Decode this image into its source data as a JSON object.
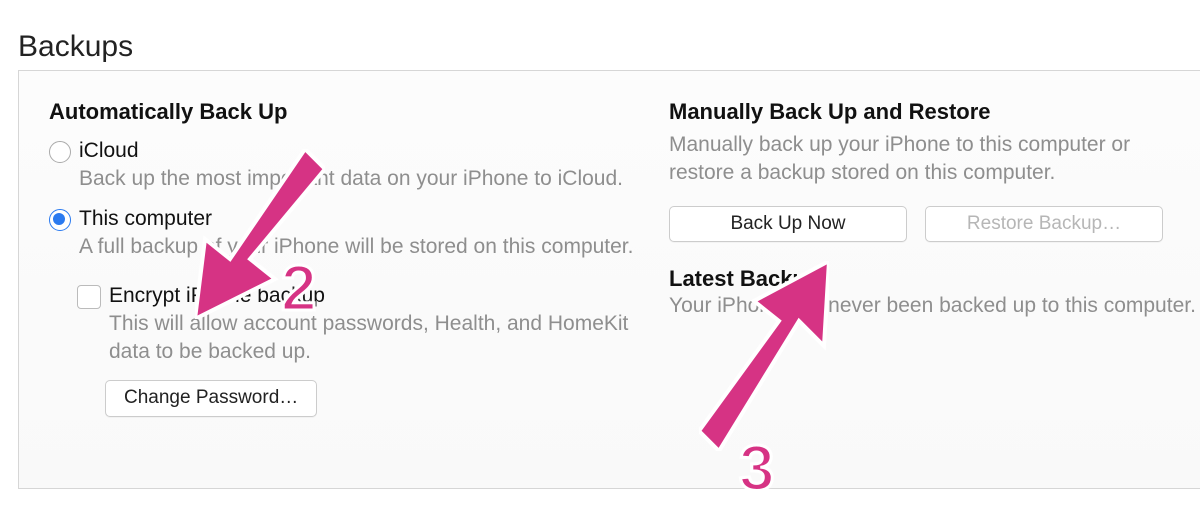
{
  "section_title": "Backups",
  "auto": {
    "heading": "Automatically Back Up",
    "icloud": {
      "label": "iCloud",
      "desc": "Back up the most important data on your iPhone to iCloud."
    },
    "this_computer": {
      "label": "This computer",
      "desc": "A full backup of your iPhone will be stored on this computer."
    },
    "encrypt": {
      "label": "Encrypt iPhone backup",
      "desc": "This will allow account passwords, Health, and HomeKit data to be backed up."
    },
    "change_password": "Change Password…"
  },
  "manual": {
    "heading": "Manually Back Up and Restore",
    "desc": "Manually back up your iPhone to this computer or restore a backup stored on this computer.",
    "back_up_now": "Back Up Now",
    "restore": "Restore Backup…"
  },
  "latest": {
    "label": "Latest Backup:",
    "value": "Your iPhone has never been backed up to this computer."
  },
  "annotations": {
    "step2": "2",
    "step3": "3"
  }
}
